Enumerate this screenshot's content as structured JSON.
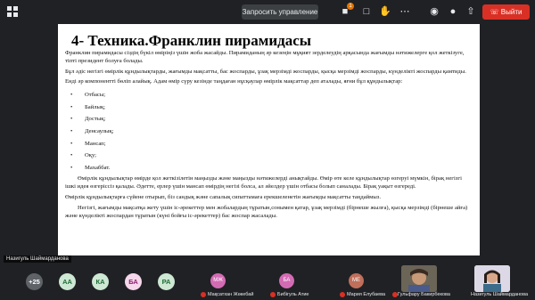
{
  "topbar": {
    "request_control_label": "Запросить управление",
    "notification_count": "1",
    "exit_label": "Выйти",
    "colors": {
      "exit": "#d93025",
      "badge": "#e37400"
    }
  },
  "slide": {
    "title": "4- Техника.Франклин пирамидасы",
    "paragraphs": [
      "Франклин пирамидасы сіздің бүкіл өміріңіз үшін жоба жасайды. Пирамиданың әр кезеңін мұқият зерделеудің арқасында жағымды нәтижелерге қол жеткізуге, тіпті президент болуға болады.",
      "Бұл әдіс негізгі өмірлік құндылықтарды, жағымды мақсатты, бас жоспарды, ұзақ мерзімді жоспарды, қысқа мерзімді жоспарды, күнделікті жоспарды қамтиды.",
      "Енді әр компонентті бөліп алайық. Адам өмір сүру кезінде таңдаған нұсқаулар өмірлік мақсаттар деп аталады, яғни бұл құндылықтар:"
    ],
    "list": [
      "Отбасы;",
      "Байлық;",
      "Достық;",
      "Денсаулық;",
      "Мансап;",
      "Оқу;",
      "Махаббат."
    ],
    "after_list": [
      "Өмірлік құндылықтар өмірде қол жеткізілетін маңызды және маңызды нәтижелерді анықтайды. Өмір өте келе құндылықтар өзгеруі мүмкін, бірақ негізгі ішкі идея өзгеріссіз қалады. Әдетте, ерлер үшін мансап өмірдің негізі болса, ал әйелдер үшін отбасы болып саналады. Бірақ уақыт өзгереді.",
      "Өмірлік құндылықтарға сүйене отырып, біз сандық және сапалық сипаттамаға ерекшеленетін жағымды мақсатты таңдаймыз.",
      "Негізгі, жағымды мақсатқа жету үшін іс-әрекеттер мен жобалардың тұратын,сонымен қатар, ұзақ мерзімді (бірнеше жылға), қысқа мерзімді (бірнеше айға) және күнделікті жоспардан тұратын (күні бойғы іс-әрекеттер) бас жоспар жасалады."
    ]
  },
  "presenter_name": "Назигуль Шаймарданова",
  "participants": {
    "more_count": "+25",
    "bubbles": [
      {
        "initials": "АА",
        "bg": "#cde8d3",
        "fg": "#1e6b35"
      },
      {
        "initials": "КА",
        "bg": "#cde8d3",
        "fg": "#1e6b35"
      },
      {
        "initials": "БА",
        "bg": "#f6d7ec",
        "fg": "#8e2470"
      },
      {
        "initials": "РА",
        "bg": "#cde8d3",
        "fg": "#1e6b35"
      }
    ],
    "tiles": [
      {
        "initials": "МЖ",
        "name": "Мақсатхан Жөкебай",
        "bg": "#d36bb4"
      },
      {
        "initials": "БА",
        "name": "Бибігуль Атиe",
        "bg": "#d36bb4"
      },
      {
        "initials": "МЕ",
        "name": "Мария Елубаева",
        "bg": "#bf6f5a"
      }
    ],
    "video_tiles": [
      {
        "name": "Гульфару Бакирбекова"
      },
      {
        "name": "Назигуль Шаймарданова"
      }
    ]
  }
}
